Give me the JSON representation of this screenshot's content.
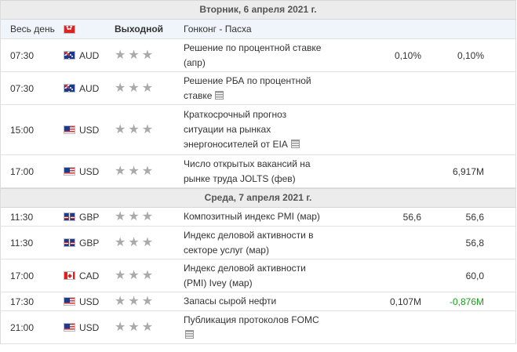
{
  "days": [
    {
      "date_label": "Вторник, 6 апреля 2021 г.",
      "holiday": {
        "time": "Весь день",
        "flag": "hk-flag-icon",
        "label": "Выходной",
        "event": "Гонконг - Пасха"
      },
      "events": [
        {
          "time": "07:30",
          "flag": "au-flag-icon",
          "currency": "AUD",
          "importance": 3,
          "event": "Решение по процентной ставке (апр)",
          "has_doc": false,
          "fact": "0,10%",
          "forecast": "",
          "previous": "0,10%",
          "prev_color": ""
        },
        {
          "time": "07:30",
          "flag": "au-flag-icon",
          "currency": "AUD",
          "importance": 3,
          "event": "Решение РБА по процентной ставке",
          "has_doc": true,
          "fact": "",
          "forecast": "",
          "previous": "",
          "prev_color": ""
        },
        {
          "time": "15:00",
          "flag": "us-flag-icon",
          "currency": "USD",
          "importance": 3,
          "event": "Краткосрочный прогноз ситуации на рынках энергоносителей от EIA",
          "has_doc": true,
          "fact": "",
          "forecast": "",
          "previous": "",
          "prev_color": ""
        },
        {
          "time": "17:00",
          "flag": "us-flag-icon",
          "currency": "USD",
          "importance": 3,
          "event": "Число открытых вакансий на рынке труда JOLTS (фев)",
          "has_doc": false,
          "fact": "",
          "forecast": "",
          "previous": "6,917M",
          "prev_color": ""
        }
      ]
    },
    {
      "date_label": "Среда, 7 апреля 2021 г.",
      "events": [
        {
          "time": "11:30",
          "flag": "gb-flag-icon",
          "currency": "GBP",
          "importance": 3,
          "event": "Композитный индекс PMI (мар)",
          "has_doc": false,
          "fact": "56,6",
          "forecast": "",
          "previous": "56,6",
          "prev_color": ""
        },
        {
          "time": "11:30",
          "flag": "gb-flag-icon",
          "currency": "GBP",
          "importance": 3,
          "event": "Индекс деловой активности в секторе услуг (мар)",
          "has_doc": false,
          "fact": "",
          "forecast": "",
          "previous": "56,8",
          "prev_color": ""
        },
        {
          "time": "17:00",
          "flag": "ca-flag-icon",
          "currency": "CAD",
          "importance": 3,
          "event": "Индекс деловой активности (PMI) Ivey (мар)",
          "has_doc": false,
          "fact": "",
          "forecast": "",
          "previous": "60,0",
          "prev_color": ""
        },
        {
          "time": "17:30",
          "flag": "us-flag-icon",
          "currency": "USD",
          "importance": 3,
          "event": "Запасы сырой нефти",
          "has_doc": false,
          "fact": "0,107M",
          "forecast": "",
          "previous": "-0,876M",
          "prev_color": "#1a9e1a"
        },
        {
          "time": "21:00",
          "flag": "us-flag-icon",
          "currency": "USD",
          "importance": 3,
          "event": "Публикация протоколов FOMC",
          "has_doc": true,
          "fact": "",
          "forecast": "",
          "previous": "",
          "prev_color": ""
        }
      ]
    }
  ]
}
